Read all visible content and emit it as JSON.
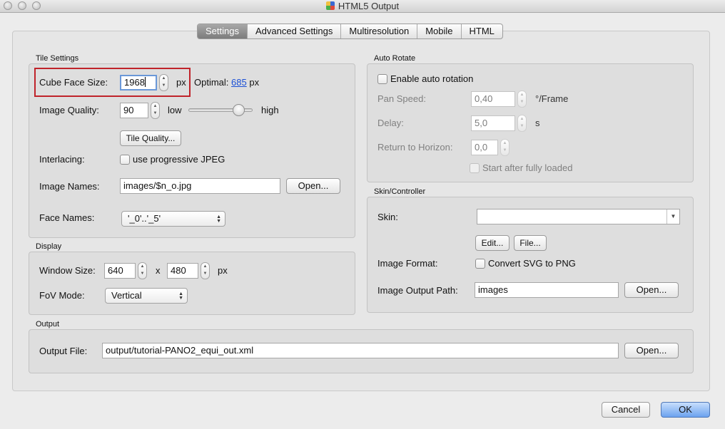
{
  "window": {
    "title": "HTML5 Output"
  },
  "tabs": [
    "Settings",
    "Advanced Settings",
    "Multiresolution",
    "Mobile",
    "HTML"
  ],
  "tile_settings": {
    "group_label": "Tile Settings",
    "cube_face_size_label": "Cube Face Size:",
    "cube_face_size_value": "1968",
    "px_unit": "px",
    "optimal_label": "Optimal:",
    "optimal_value": "685",
    "optimal_unit": "px",
    "image_quality_label": "Image Quality:",
    "image_quality_value": "90",
    "slider_low": "low",
    "slider_high": "high",
    "quality_slider_level": 0.85,
    "tile_quality_button": "Tile Quality...",
    "interlacing_label": "Interlacing:",
    "progressive_checkbox_label": "use progressive JPEG",
    "image_names_label": "Image Names:",
    "image_names_value": "images/$n_o.jpg",
    "image_names_open_button": "Open...",
    "face_names_label": "Face Names:",
    "face_names_value": "'_0'..'_5'"
  },
  "display": {
    "group_label": "Display",
    "window_size_label": "Window Size:",
    "width_value": "640",
    "times": "x",
    "height_value": "480",
    "px_unit": "px",
    "fov_mode_label": "FoV Mode:",
    "fov_mode_value": "Vertical"
  },
  "auto_rotate": {
    "group_label": "Auto Rotate",
    "enable_label": "Enable auto rotation",
    "pan_speed_label": "Pan Speed:",
    "pan_speed_value": "0,40",
    "pan_speed_unit": "°/Frame",
    "delay_label": "Delay:",
    "delay_value": "5,0",
    "delay_unit": "s",
    "return_label": "Return to Horizon:",
    "return_value": "0,0",
    "start_after_label": "Start after fully loaded"
  },
  "skin": {
    "group_label": "Skin/Controller",
    "skin_label": "Skin:",
    "skin_value": "",
    "edit_button": "Edit...",
    "file_button": "File...",
    "image_format_label": "Image Format:",
    "convert_label": "Convert SVG to PNG",
    "output_path_label": "Image Output Path:",
    "output_path_value": "images",
    "output_path_open_button": "Open..."
  },
  "output": {
    "group_label": "Output",
    "output_file_label": "Output File:",
    "output_file_value": "output/tutorial-PANO2_equi_out.xml",
    "open_button": "Open..."
  },
  "dialog_buttons": {
    "cancel": "Cancel",
    "ok": "OK"
  },
  "colors": {
    "highlight_box": "#c0232a",
    "link": "#1a4fd6",
    "ok_button": "#6ca2ef"
  }
}
